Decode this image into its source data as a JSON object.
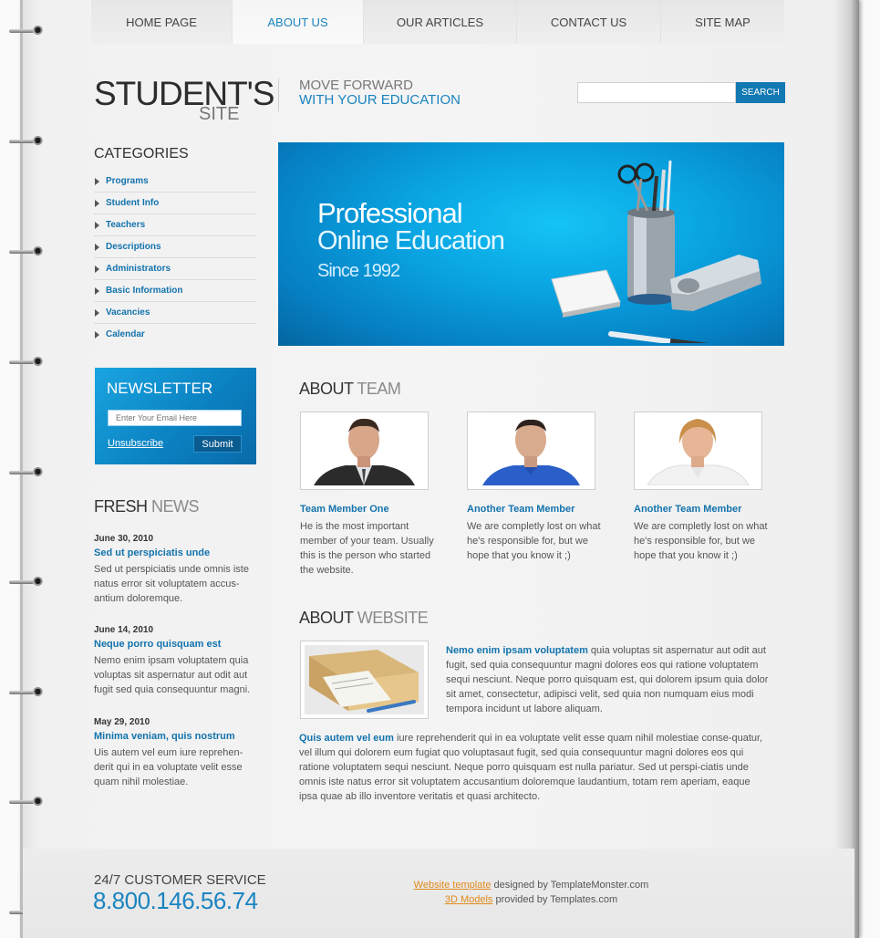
{
  "nav": {
    "items": [
      {
        "label": "HOME PAGE",
        "active": false
      },
      {
        "label": "ABOUT US",
        "active": true
      },
      {
        "label": "OUR ARTICLES",
        "active": false
      },
      {
        "label": "CONTACT US",
        "active": false
      },
      {
        "label": "SITE MAP",
        "active": false
      }
    ]
  },
  "header": {
    "logo_big": "STUDENT'S",
    "logo_small": "SITE",
    "tagline_1": "MOVE FORWARD",
    "tagline_2": "WITH YOUR EDUCATION"
  },
  "search": {
    "value": "",
    "placeholder": "",
    "button": "SEARCH"
  },
  "categories": {
    "title": "CATEGORIES",
    "items": [
      "Programs",
      "Student Info",
      "Teachers",
      "Descriptions",
      "Administrators",
      "Basic Information",
      "Vacancies",
      "Calendar"
    ]
  },
  "banner": {
    "line1": "Professional",
    "line2": "Online Education",
    "line3": "Since 1992"
  },
  "newsletter": {
    "title": "NEWSLETTER",
    "placeholder": "Enter Your Email Here",
    "unsubscribe": "Unsubscribe",
    "submit": "Submit"
  },
  "fresh_news": {
    "title_a": "FRESH",
    "title_b": "NEWS",
    "items": [
      {
        "date": "June 30, 2010",
        "headline": "Sed ut perspiciatis unde",
        "text": "Sed ut perspiciatis unde omnis iste natus error sit voluptatem accus-antium doloremque."
      },
      {
        "date": "June 14, 2010",
        "headline": "Neque porro quisquam est",
        "text": "Nemo enim ipsam voluptatem quia voluptas sit aspernatur aut odit aut fugit sed quia consequuntur magni."
      },
      {
        "date": "May 29, 2010",
        "headline": "Minima veniam, quis nostrum",
        "text": "Uis autem vel eum iure reprehen-derit qui in ea voluptate velit esse quam nihil molestiae."
      }
    ]
  },
  "about_team": {
    "title_a": "ABOUT",
    "title_b": "TEAM",
    "members": [
      {
        "name": "Team Member One",
        "desc": "He is the most important member of your team. Usually this is the person who started the website."
      },
      {
        "name": "Another Team Member",
        "desc": "We are completly lost on what he's responsible for, but we hope that you know it ;)"
      },
      {
        "name": "Another Team Member",
        "desc": "We are completly lost on what he's responsible for, but we hope that you know it ;)"
      }
    ]
  },
  "about_website": {
    "title_a": "ABOUT",
    "title_b": "WEBSITE",
    "p1_lead": "Nemo enim ipsam voluptatem",
    "p1_text": " quia voluptas sit aspernatur aut odit aut fugit, sed quia consequuntur magni dolores eos qui ratione voluptatem sequi nesciunt. Neque porro quisquam est, qui dolorem ipsum quia dolor sit amet, consectetur, adipisci velit, sed quia non numquam eius modi tempora incidunt ut labore aliquam.",
    "p2_lead": "Quis autem vel eum",
    "p2_text": " iure reprehenderit qui in ea voluptate velit esse quam nihil molestiae conse-quatur, vel illum qui dolorem eum fugiat quo voluptasaut fugit, sed quia consequuntur magni dolores eos qui ratione voluptatem sequi nesciunt. Neque porro quisquam est nulla pariatur. Sed ut perspi-ciatis unde omnis iste natus error sit voluptatem accusantium doloremque laudantium, totam rem aperiam, eaque ipsa quae ab illo inventore veritatis et quasi architecto."
  },
  "footer": {
    "cs_title": "24/7 CUSTOMER SERVICE",
    "phone": "8.800.146.56.74",
    "credit1_link": "Website template",
    "credit1_text": " designed by TemplateMonster.com",
    "credit2_link": "3D Models",
    "credit2_text": " provided by Templates.com"
  },
  "colors": {
    "accent": "#1a84c0",
    "link": "#1373ad",
    "footer_link": "#e08a1c"
  }
}
